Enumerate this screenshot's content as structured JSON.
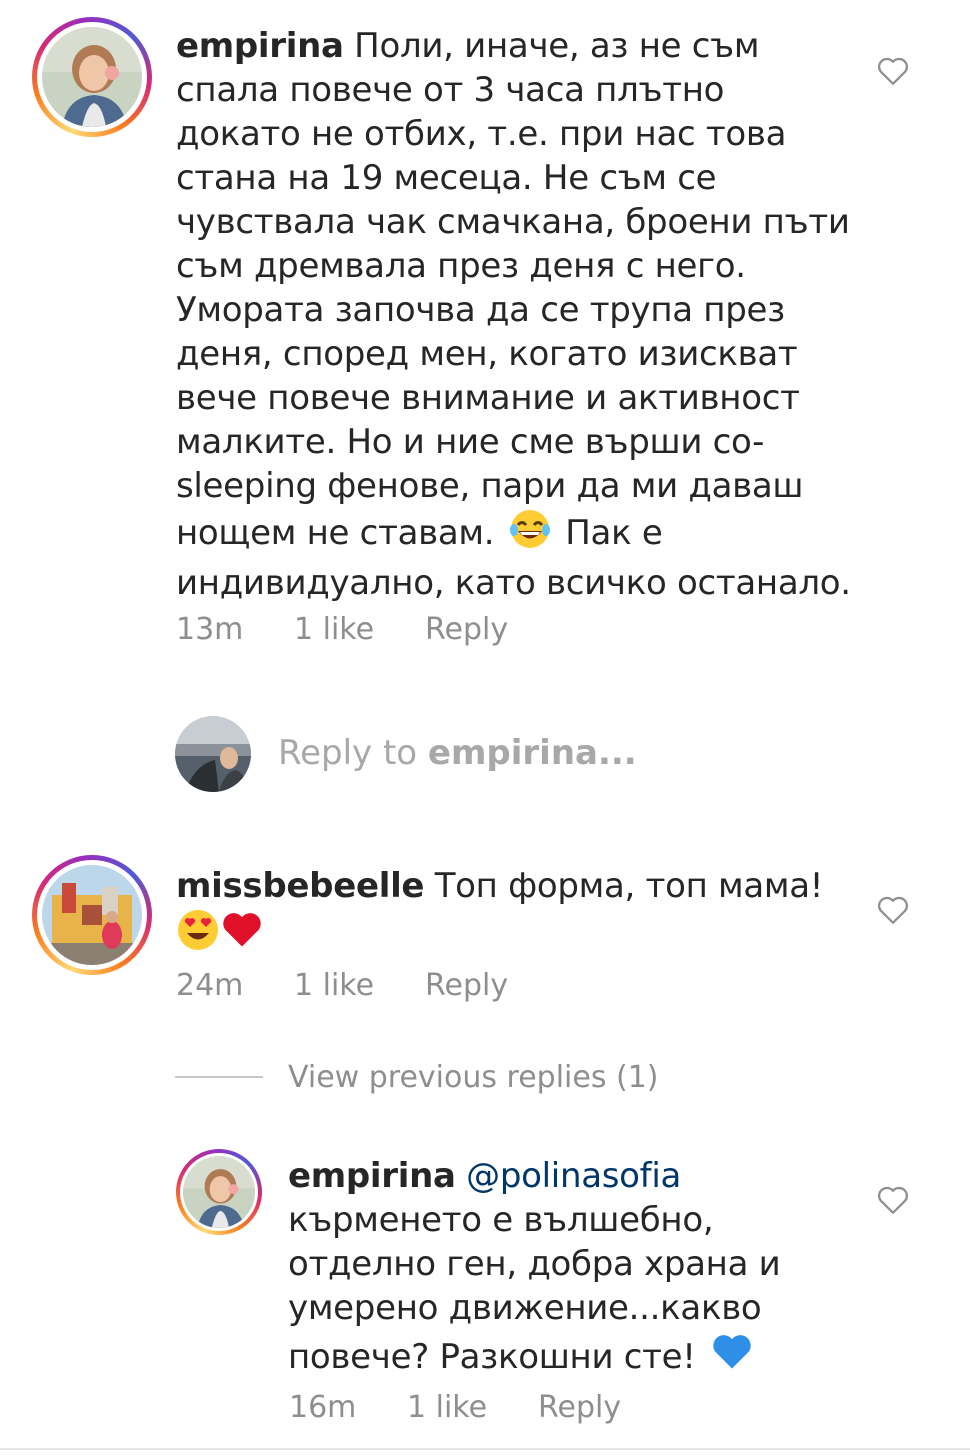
{
  "comments": [
    {
      "username": "empirina",
      "text": "Поли, иначе, аз не съм спала повече от 3 часа плътно докато не отбих, т.е. при нас това стана на 19 месеца. Не съм се чувствала чак смачкана, броени пъти съм дремвала през деня с него. Умората започва да се трупа през деня, според мен, когато изискват вече повече внимание и активност малките. Но и ние сме върши co-sleeping фенове, пари да ми даваш нощем не ставам.",
      "emoji": "😂",
      "text_after": "Пак е индивидуално, като всичко останало.",
      "time": "13m",
      "likes": "1 like",
      "reply_label": "Reply",
      "avatar_icon": "profile-photo-girl-headphones"
    },
    {
      "username": "missbebeelle",
      "text": "Топ форма, топ мама!",
      "emojis": "😍❤️",
      "time": "24m",
      "likes": "1 like",
      "reply_label": "Reply",
      "avatar_icon": "profile-photo-colorful-palace"
    }
  ],
  "reply_input": {
    "prefix": "Reply to",
    "target": "empirina...",
    "avatar_icon": "profile-photo-city-view"
  },
  "view_previous": "View previous replies (1)",
  "reply": {
    "username": "empirina",
    "mention": "@polinasofia",
    "text": "кърменето е вълшебно, отделно ген, добра храна и умерено движение...какво повече? Разкошни сте!",
    "emoji": "💙",
    "time": "16m",
    "likes": "1 like",
    "reply_label": "Reply"
  },
  "colors": {
    "text": "#262626",
    "secondary": "#8e8e8e",
    "mention": "#00376b",
    "placeholder": "#a8a8a8"
  }
}
